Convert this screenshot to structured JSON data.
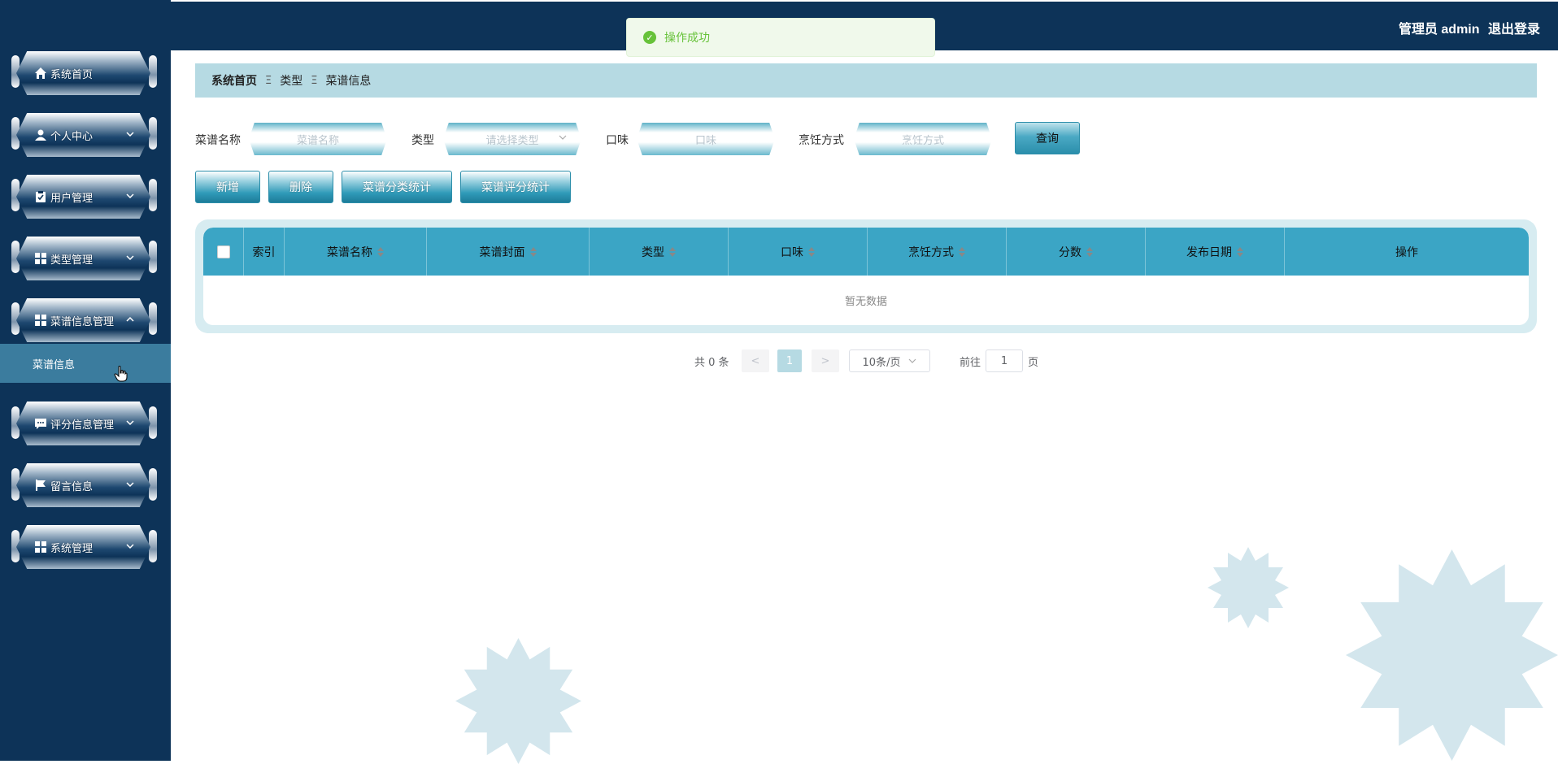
{
  "topbar": {
    "user_label": "管理员 admin",
    "logout_label": "退出登录"
  },
  "toast": {
    "message": "操作成功"
  },
  "sidebar": {
    "items": [
      {
        "label": "系统首页",
        "icon": "home-icon"
      },
      {
        "label": "个人中心",
        "icon": "user-icon"
      },
      {
        "label": "用户管理",
        "icon": "clipboard-icon"
      },
      {
        "label": "类型管理",
        "icon": "grid-icon"
      },
      {
        "label": "菜谱信息管理",
        "icon": "grid-icon",
        "expanded": true
      },
      {
        "label": "评分信息管理",
        "icon": "chat-icon"
      },
      {
        "label": "留言信息",
        "icon": "flag-icon"
      },
      {
        "label": "系统管理",
        "icon": "grid-icon"
      }
    ],
    "submenu": {
      "label": "菜谱信息"
    }
  },
  "breadcrumb": {
    "items": [
      "系统首页",
      "类型",
      "菜谱信息"
    ],
    "separator": "Ξ"
  },
  "search": {
    "fields": [
      {
        "label": "菜谱名称",
        "placeholder": "菜谱名称"
      },
      {
        "label": "类型",
        "placeholder": "请选择类型"
      },
      {
        "label": "口味",
        "placeholder": "口味"
      },
      {
        "label": "烹饪方式",
        "placeholder": "烹饪方式"
      }
    ],
    "query_label": "查询"
  },
  "actions": {
    "add_label": "新增",
    "delete_label": "删除",
    "category_stats_label": "菜谱分类统计",
    "rating_stats_label": "菜谱评分统计"
  },
  "table": {
    "columns": [
      "索引",
      "菜谱名称",
      "菜谱封面",
      "类型",
      "口味",
      "烹饪方式",
      "分数",
      "发布日期",
      "操作"
    ],
    "empty_text": "暂无数据"
  },
  "pagination": {
    "total_text": "共 0 条",
    "prev": "<",
    "current_page": "1",
    "next": ">",
    "page_size": "10条/页",
    "goto_label": "前往",
    "goto_value": "1",
    "page_suffix": "页"
  },
  "colors": {
    "sidebar_bg": "#0d3358",
    "accent": "#3ba5c5",
    "breadcrumb_bg": "#b6dae3",
    "success": "#67c23a"
  }
}
